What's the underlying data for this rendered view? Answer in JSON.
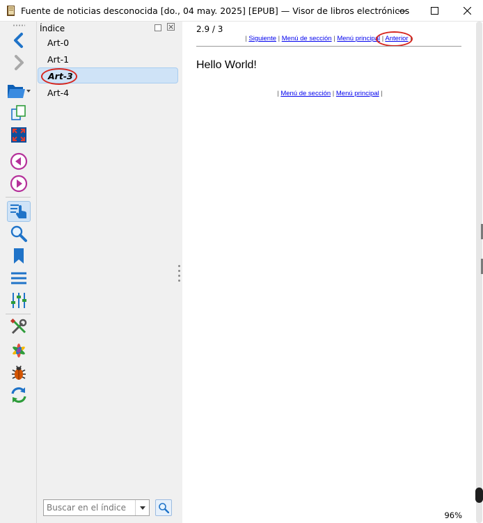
{
  "window": {
    "title": "Fuente de noticias desconocida [do., 04 may. 2025] [EPUB] — Visor de libros electrónicos",
    "minimize": "—",
    "maximize": "☐",
    "close": "✕"
  },
  "toolbar": {
    "buttons": [
      {
        "name": "back-icon"
      },
      {
        "name": "forward-icon"
      },
      {
        "name": "open-book-icon"
      },
      {
        "name": "copy-icon"
      },
      {
        "name": "fullscreen-icon"
      },
      {
        "name": "previous-icon"
      },
      {
        "name": "next-icon"
      },
      {
        "name": "toc-icon",
        "active": true
      },
      {
        "name": "search-icon"
      },
      {
        "name": "bookmark-icon"
      },
      {
        "name": "menu-icon"
      },
      {
        "name": "preferences-icon"
      },
      {
        "name": "tools-icon"
      },
      {
        "name": "plugins-icon"
      },
      {
        "name": "debug-icon"
      },
      {
        "name": "reload-icon"
      }
    ]
  },
  "toc": {
    "title": "Índice",
    "items": [
      {
        "label": "Art-0",
        "selected": false
      },
      {
        "label": "Art-1",
        "selected": false
      },
      {
        "label": "Art-3",
        "selected": true
      },
      {
        "label": "Art-4",
        "selected": false
      }
    ],
    "search_placeholder": "Buscar en el índice"
  },
  "content": {
    "position": "2.9 / 3",
    "nav_top": {
      "sep": "|",
      "siguiente": "Siguiente",
      "menu_seccion": "Menú de sección",
      "menu_principal": "Menú principal",
      "anterior": "Anterior"
    },
    "heading": "Hello World!",
    "nav_bottom": {
      "sep": "|",
      "menu_seccion": "Menú de sección",
      "menu_principal": "Menú principal"
    },
    "zoom": "96%"
  },
  "colors": {
    "accent": "#1a6fd4",
    "highlight_red": "#d7261e",
    "selection": "#cfe3f7"
  }
}
